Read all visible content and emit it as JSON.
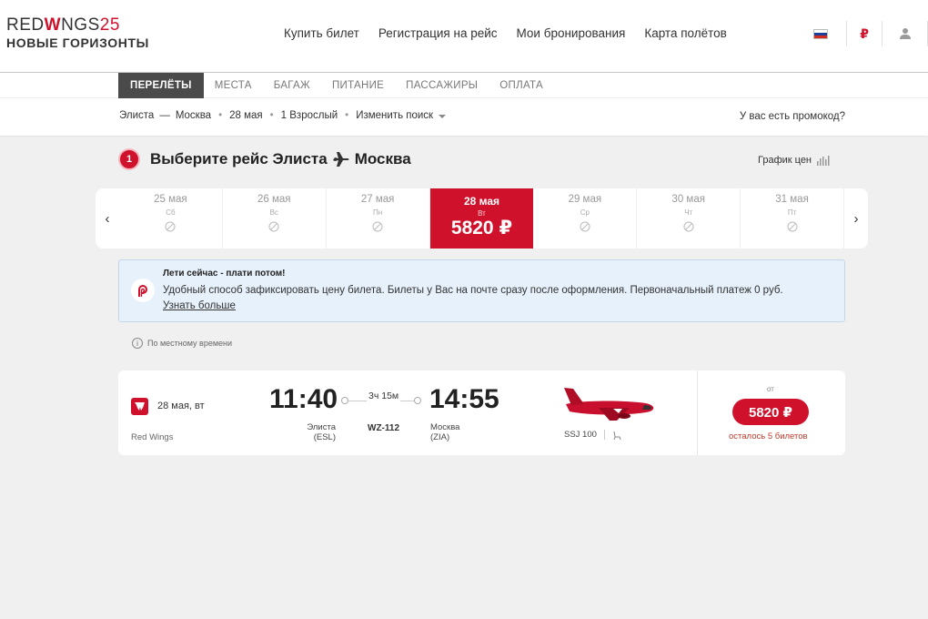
{
  "header": {
    "logo_main": "RED",
    "logo_w": "W",
    "logo_rest": "NGS",
    "logo_num": "25",
    "logo_sub": "НОВЫЕ ГОРИЗОНТЫ",
    "nav": [
      "Купить билет",
      "Регистрация на рейс",
      "Мои бронирования",
      "Карта полётов"
    ],
    "currency_symbol": "₽"
  },
  "tabs": [
    "ПЕРЕЛЁТЫ",
    "МЕСТА",
    "БАГАЖ",
    "ПИТАНИЕ",
    "ПАССАЖИРЫ",
    "ОПЛАТА"
  ],
  "active_tab": "ПЕРЕЛЁТЫ",
  "search_summary": {
    "from": "Элиста",
    "dash": "—",
    "to": "Москва",
    "date": "28 мая",
    "passengers": "1 Взрослый",
    "change": "Изменить поиск",
    "promo": "У вас есть промокод?"
  },
  "step": {
    "number": "1",
    "title_prefix": "Выберите рейс Элиста",
    "title_dest": "Москва",
    "price_graph": "График цен"
  },
  "date_strip": [
    {
      "date": "25 мая",
      "weekday": "Сб",
      "price": null
    },
    {
      "date": "26 мая",
      "weekday": "Вс",
      "price": null
    },
    {
      "date": "27 мая",
      "weekday": "Пн",
      "price": null
    },
    {
      "date": "28 мая",
      "weekday": "Вт",
      "price": "5820 ₽",
      "selected": true
    },
    {
      "date": "29 мая",
      "weekday": "Ср",
      "price": null
    },
    {
      "date": "30 мая",
      "weekday": "Чт",
      "price": null
    },
    {
      "date": "31 мая",
      "weekday": "Пт",
      "price": null
    }
  ],
  "banner": {
    "title": "Лети сейчас - плати потом!",
    "text": "Удобный способ зафиксировать цену билета. Билеты у Вас на почте сразу после оформления. Первоначальный платеж 0 руб.",
    "link": "Узнать больше"
  },
  "local_time_note": "По местному времени",
  "flight": {
    "date": "28 мая, вт",
    "airline": "Red Wings",
    "departure_time": "11:40",
    "arrival_time": "14:55",
    "duration": "3ч 15м",
    "departure_city": "Элиста",
    "departure_code": "(ESL)",
    "arrival_city": "Москва",
    "arrival_code": "(ZIA)",
    "flight_number": "WZ-112",
    "aircraft": "SSJ 100",
    "price_from": "от",
    "price": "5820 ₽",
    "seats_left": "осталось 5 билетов"
  },
  "colors": {
    "brand_red": "#d0112b",
    "banner_bg": "#e7f1fb",
    "page_bg": "#f0f0f0"
  }
}
